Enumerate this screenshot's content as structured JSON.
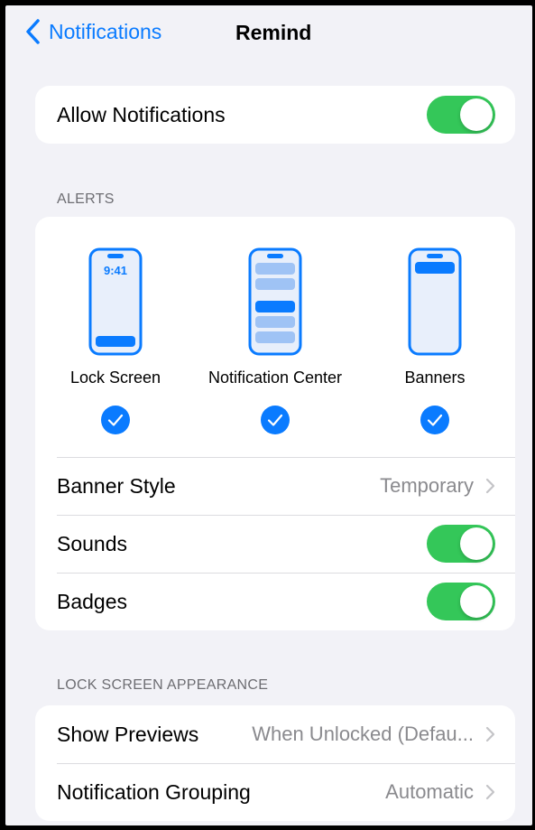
{
  "nav": {
    "back_label": "Notifications",
    "title": "Remind"
  },
  "allow": {
    "label": "Allow Notifications",
    "on": true
  },
  "alerts": {
    "header": "ALERTS",
    "options": [
      {
        "label": "Lock Screen",
        "time": "9:41",
        "checked": true
      },
      {
        "label": "Notification Center",
        "checked": true
      },
      {
        "label": "Banners",
        "checked": true
      }
    ],
    "banner_style": {
      "label": "Banner Style",
      "value": "Temporary"
    },
    "sounds": {
      "label": "Sounds",
      "on": true
    },
    "badges": {
      "label": "Badges",
      "on": true
    }
  },
  "lock_screen": {
    "header": "LOCK SCREEN APPEARANCE",
    "show_previews": {
      "label": "Show Previews",
      "value": "When Unlocked (Defau..."
    },
    "grouping": {
      "label": "Notification Grouping",
      "value": "Automatic"
    }
  },
  "colors": {
    "accent": "#0a7bff",
    "toggle_on": "#34c759",
    "background": "#f2f2f7"
  }
}
